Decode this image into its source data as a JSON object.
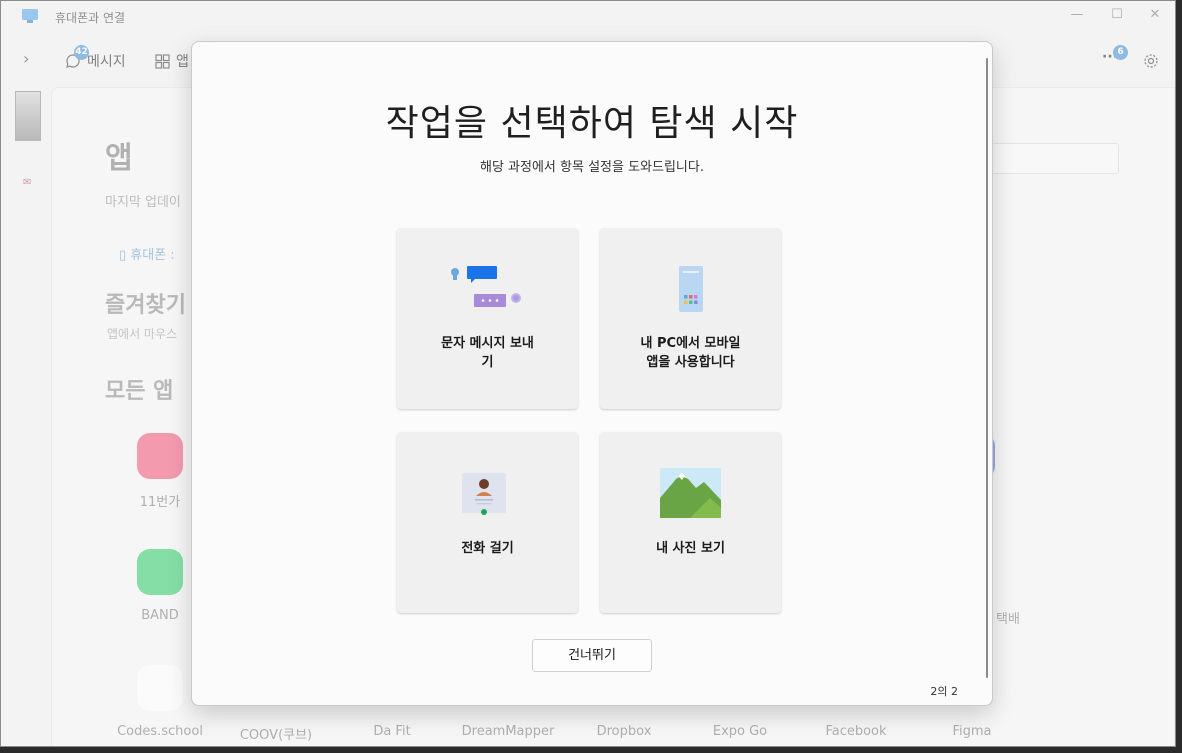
{
  "window": {
    "title": "휴대폰과 연결",
    "minimize": "—",
    "maximize": "☐",
    "close": "✕"
  },
  "nav": {
    "messages_label": "메시지",
    "messages_badge": "42",
    "apps_label": "앱",
    "more_badge": "6",
    "more": "···"
  },
  "background": {
    "title": "앱",
    "subtitle": "마지막 업데이",
    "phone_link": "휴대폰 :",
    "favorites_title": "즐겨찾기",
    "favorites_sub": "앱에서 마우스",
    "all_apps_title": "모든 앱",
    "apps": [
      {
        "label": "11번가",
        "color": "#f56b8a"
      },
      {
        "label": "BAND",
        "color": "#4cd37f"
      },
      {
        "label": "Codes.school",
        "color": "#ffffff"
      },
      {
        "label": "COOV(쿠브)",
        "color": "#3c6fd6"
      },
      {
        "label": "Da Fit",
        "color": "#333333"
      },
      {
        "label": "DreamMapper",
        "color": "#d9e4f2"
      },
      {
        "label": "Dropbox",
        "color": "#0061fe"
      },
      {
        "label": "Expo Go",
        "color": "#222222"
      },
      {
        "label": "Facebook",
        "color": "#1877f2"
      },
      {
        "label": "Figma",
        "color": "#1e1e1e"
      },
      {
        "label": "택배",
        "color": "#6a7fd8"
      }
    ]
  },
  "dialog": {
    "title": "작업을 선택하여 탐색 시작",
    "subtitle": "해당 과정에서 항목 설정을 도와드립니다.",
    "cards": [
      {
        "line1": "문자 메시지 보내",
        "line2": "기"
      },
      {
        "line1": "내 PC에서 모바일",
        "line2": "앱을 사용합니다"
      },
      {
        "line1": "전화 걸기",
        "line2": ""
      },
      {
        "line1": "내 사진 보기",
        "line2": ""
      }
    ],
    "skip_label": "건너뛰기",
    "pager": "2의 2"
  },
  "colors": {
    "accent": "#0f6cbd",
    "badge": "#5a9bd8",
    "message_blue": "#1a73e8",
    "message_purple": "#a78bd9"
  }
}
